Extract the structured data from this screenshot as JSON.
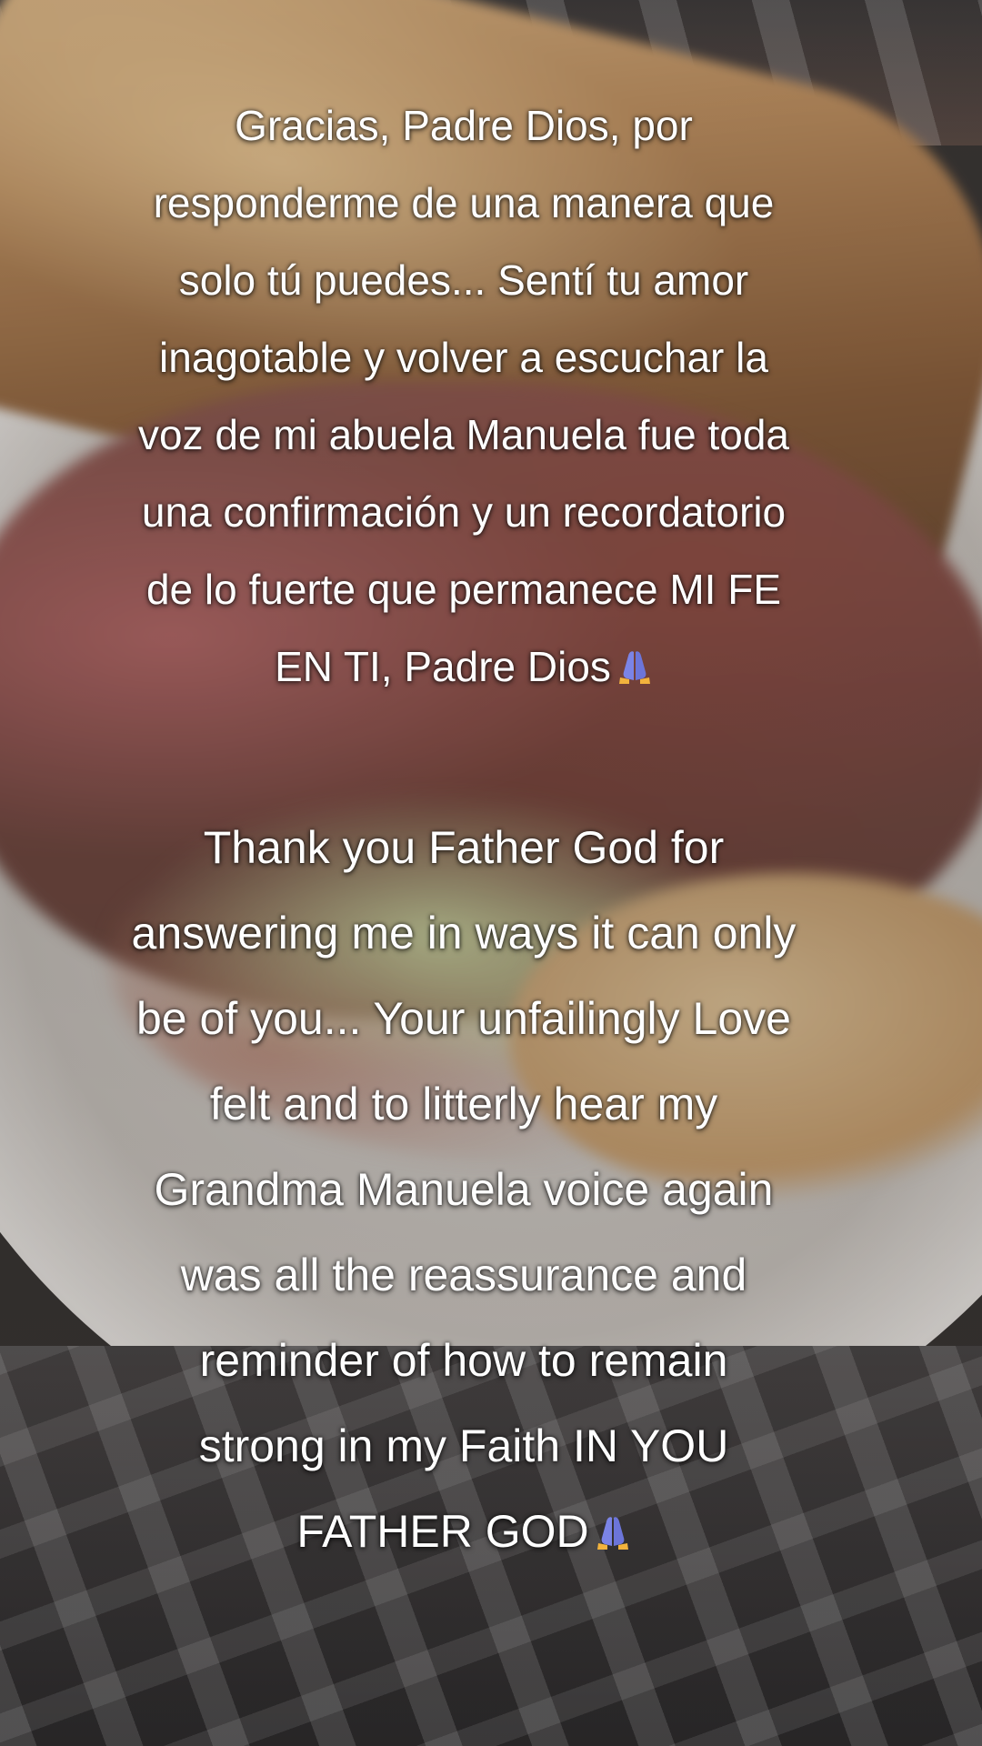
{
  "caption_spanish": {
    "text": "Gracias, Padre Dios, por\nresponderme de una manera que\nsolo tú puedes... Sentí tu amor\ninagotable y volver a escuchar la\nvoz de mi abuela Manuela fue toda\nuna confirmación y un recordatorio\nde lo fuerte que permanece MI FE\nEN TI, Padre Dios",
    "trailing_icon": "praying-hands-emoji"
  },
  "caption_english": {
    "text": "Thank you Father God for\nanswering me in ways it can only\nbe of you... Your unfailingly Love\nfelt and to litterly hear my\nGrandma Manuela voice again\nwas all the reassurance and\nreminder of how to remain\nstrong in my Faith IN YOU\nFATHER GOD",
    "trailing_icon": "praying-hands-emoji"
  },
  "background": {
    "description_icon": "sandwich-photo",
    "caption_color": "#ffffff"
  }
}
